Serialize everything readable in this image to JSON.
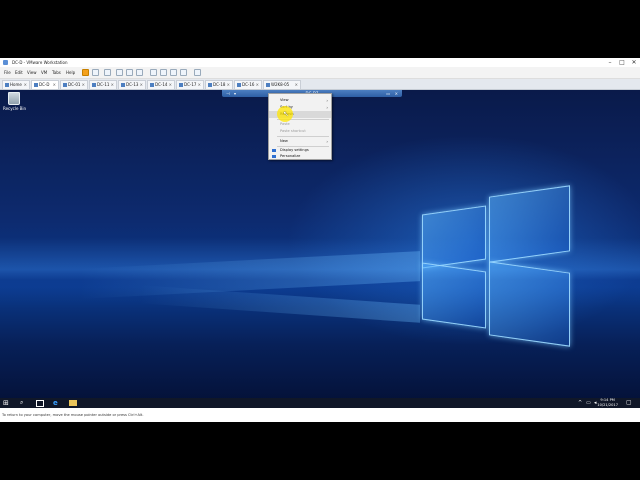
{
  "window": {
    "title": "DC-D - VMware Workstation"
  },
  "menu": {
    "items": [
      "File",
      "Edit",
      "View",
      "VM",
      "Tabs",
      "Help"
    ]
  },
  "tabs": [
    "Home",
    "DC-D",
    "DC-01",
    "DC-11",
    "DC-13",
    "DC-14",
    "DC-17",
    "DC-18",
    "DC-16",
    "W2K8-05"
  ],
  "vmbar": {
    "label": "DC-D7"
  },
  "desktop": {
    "recycle_label": "Recycle Bin"
  },
  "context_menu": {
    "items": [
      {
        "label": "View",
        "submenu": true,
        "disabled": false
      },
      {
        "label": "Sort by",
        "submenu": true,
        "disabled": false
      },
      {
        "label": "Refresh",
        "submenu": false,
        "disabled": false,
        "highlighted": true
      },
      {
        "label": "Paste",
        "submenu": false,
        "disabled": true
      },
      {
        "label": "Paste shortcut",
        "submenu": false,
        "disabled": true
      },
      {
        "label": "New",
        "submenu": true,
        "disabled": false
      },
      {
        "label": "Display settings",
        "submenu": false,
        "disabled": false,
        "icon": "display-icon"
      },
      {
        "label": "Personalize",
        "submenu": false,
        "disabled": false,
        "icon": "personalize-icon"
      }
    ]
  },
  "taskbar": {
    "time": "9:14 PM",
    "date": "10/21/2017"
  },
  "status": {
    "text": "To return to your computer, move the mouse pointer outside or press Ctrl+Alt."
  },
  "colors": {
    "accent": "#2e5fa5",
    "highlight": "#ffe600"
  }
}
